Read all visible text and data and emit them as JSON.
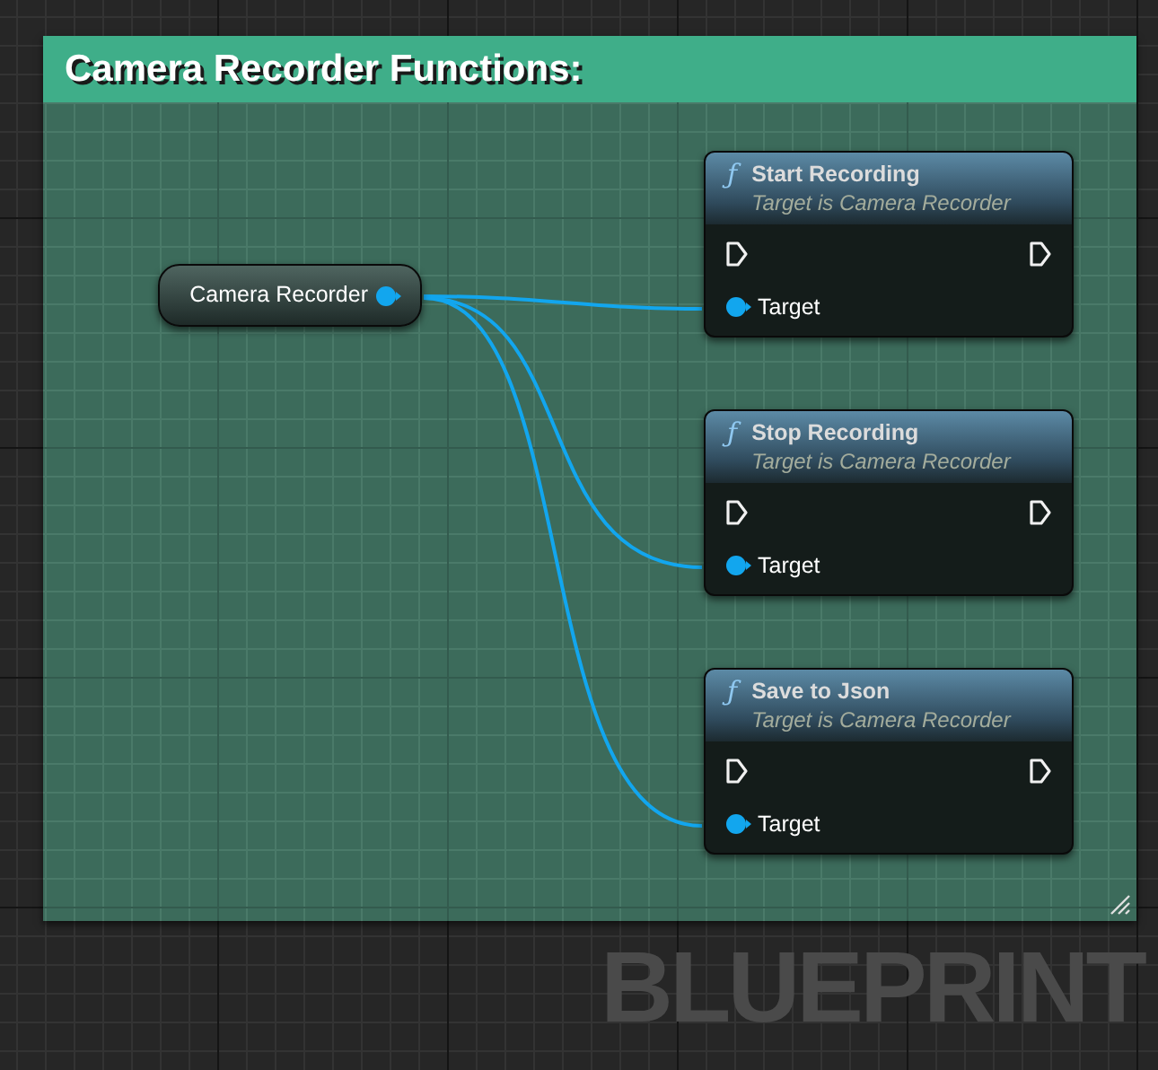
{
  "comment": {
    "title": "Camera Recorder Functions:"
  },
  "variable_node": {
    "label": "Camera Recorder"
  },
  "functions": [
    {
      "icon": "ƒ",
      "title": "Start Recording",
      "subtitle": "Target is Camera Recorder",
      "pin": "Target"
    },
    {
      "icon": "ƒ",
      "title": "Stop Recording",
      "subtitle": "Target is Camera Recorder",
      "pin": "Target"
    },
    {
      "icon": "ƒ",
      "title": "Save to Json",
      "subtitle": "Target is Camera Recorder",
      "pin": "Target"
    }
  ],
  "graph_label": "BLUEPRINT"
}
